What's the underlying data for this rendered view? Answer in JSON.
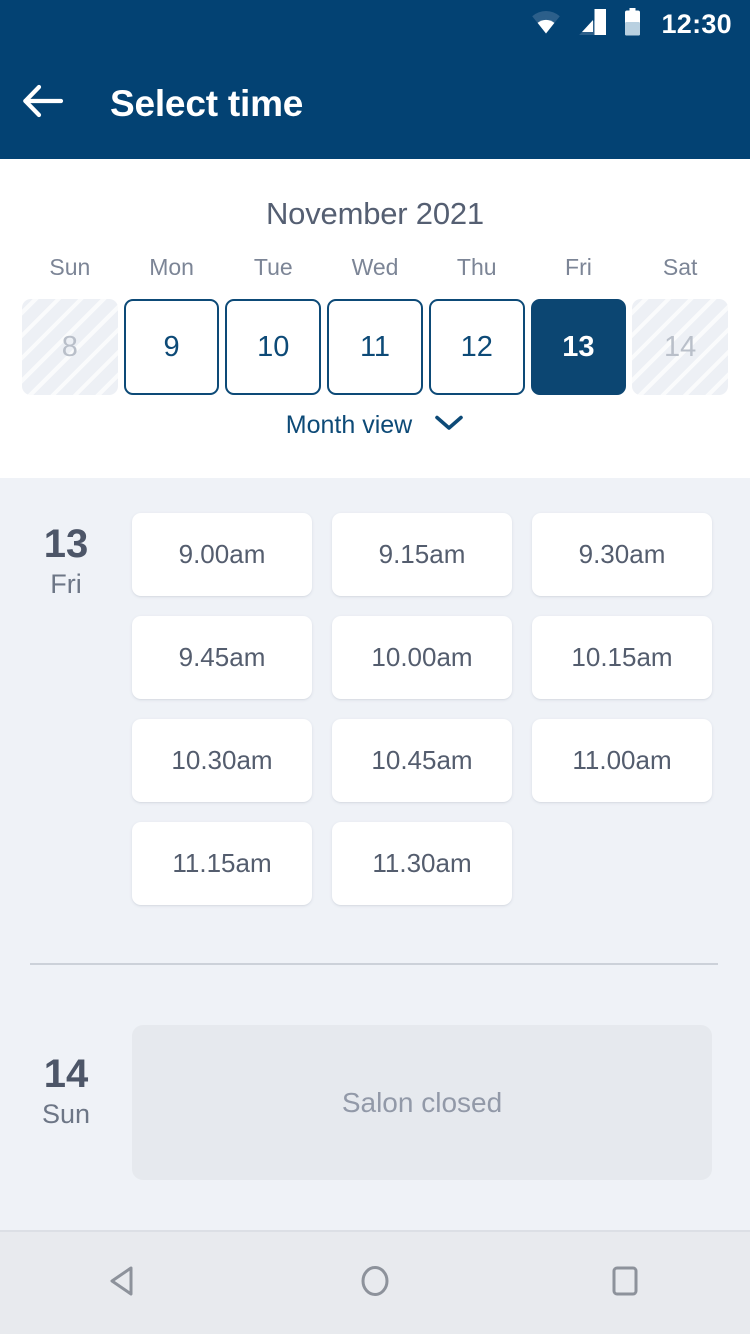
{
  "status_bar": {
    "time": "12:30",
    "icons": [
      "wifi-icon",
      "cellular-signal-icon",
      "battery-icon"
    ]
  },
  "app_bar": {
    "back_icon": "arrow-left-icon",
    "title": "Select time"
  },
  "calendar": {
    "month_label": "November 2021",
    "weekdays": [
      "Sun",
      "Mon",
      "Tue",
      "Wed",
      "Thu",
      "Fri",
      "Sat"
    ],
    "dates": [
      {
        "day": "8",
        "state": "disabled"
      },
      {
        "day": "9",
        "state": "enabled"
      },
      {
        "day": "10",
        "state": "enabled"
      },
      {
        "day": "11",
        "state": "enabled"
      },
      {
        "day": "12",
        "state": "enabled"
      },
      {
        "day": "13",
        "state": "selected"
      },
      {
        "day": "14",
        "state": "disabled"
      }
    ],
    "month_view_label": "Month view",
    "month_view_icon": "chevron-down-icon"
  },
  "days": [
    {
      "day_number": "13",
      "day_of_week": "Fri",
      "closed": false,
      "slots": [
        "9.00am",
        "9.15am",
        "9.30am",
        "9.45am",
        "10.00am",
        "10.15am",
        "10.30am",
        "10.45am",
        "11.00am",
        "11.15am",
        "11.30am"
      ]
    },
    {
      "day_number": "14",
      "day_of_week": "Sun",
      "closed": true,
      "closed_message": "Salon closed",
      "slots": []
    }
  ],
  "nav_bar": {
    "back_icon": "triangle-back-icon",
    "home_icon": "circle-home-icon",
    "recents_icon": "square-recents-icon"
  },
  "colors": {
    "brand_blue": "#034273",
    "selected_date": "#0c4672",
    "accent_link": "#0d4a77",
    "page_background": "#eff2f7",
    "slot_card": "#ffffff",
    "closed_card": "#e6e9ee"
  }
}
